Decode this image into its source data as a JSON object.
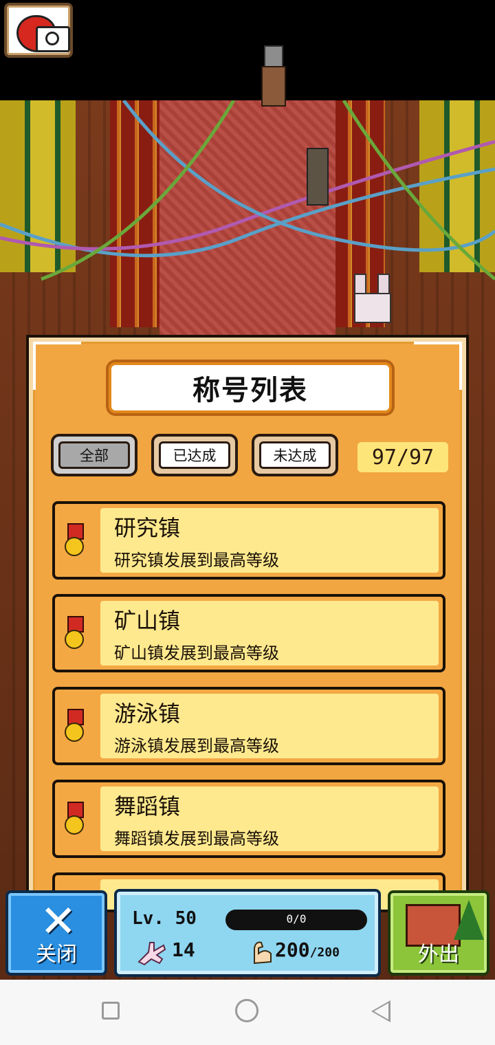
{
  "panel": {
    "title": "称号列表",
    "tabs": [
      {
        "label": "全部",
        "active": true
      },
      {
        "label": "已达成",
        "active": false
      },
      {
        "label": "未达成",
        "active": false
      }
    ],
    "count": "97/97",
    "items": [
      {
        "name": "研究镇",
        "desc": "研究镇发展到最高等级",
        "icon": "medal-icon"
      },
      {
        "name": "矿山镇",
        "desc": "矿山镇发展到最高等级",
        "icon": "medal-icon"
      },
      {
        "name": "游泳镇",
        "desc": "游泳镇发展到最高等级",
        "icon": "medal-icon"
      },
      {
        "name": "舞蹈镇",
        "desc": "舞蹈镇发展到最高等级",
        "icon": "medal-icon"
      }
    ]
  },
  "hud": {
    "close_label": "关闭",
    "level": "Lv. 50",
    "exp": "0/0",
    "coins": "14",
    "stamina": "200",
    "stamina_max": "/200",
    "out_label": "外出"
  },
  "colors": {
    "panel": "#f1a642",
    "item_bg": "#ffe98e",
    "close_btn": "#2a8fe0",
    "out_btn": "#8cc43a"
  }
}
